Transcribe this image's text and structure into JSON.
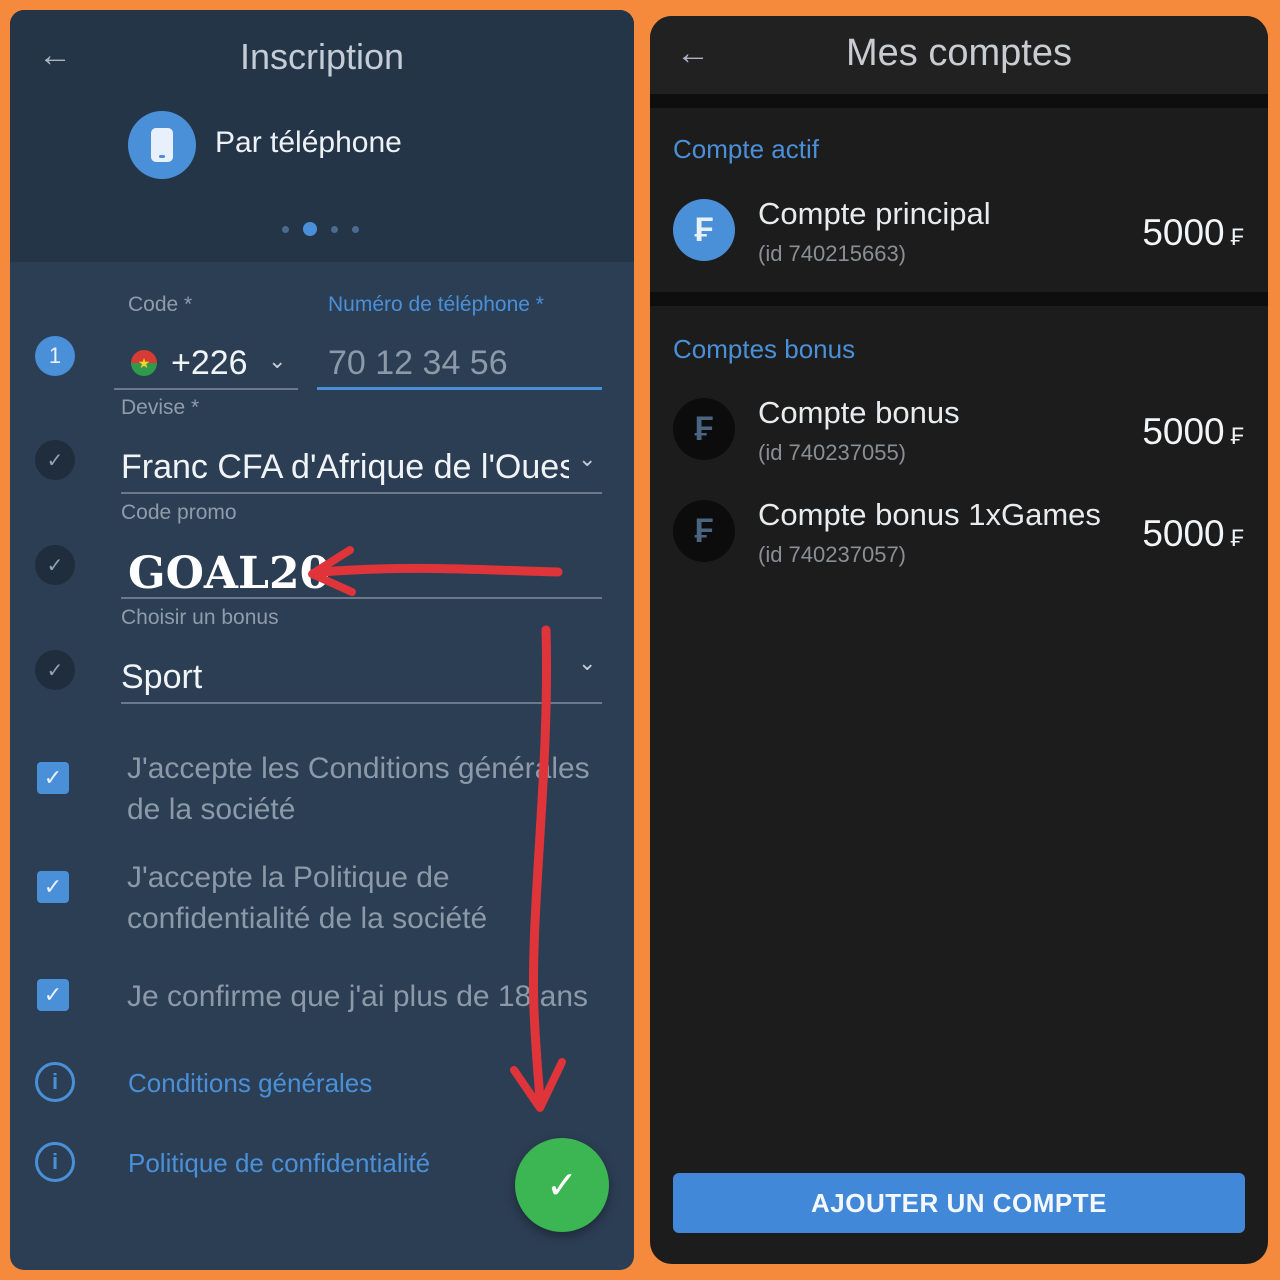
{
  "registration": {
    "title": "Inscription",
    "method_label": "Par téléphone",
    "step_number": "1",
    "code_label": "Code *",
    "code_value": "+226",
    "phone_label": "Numéro de téléphone *",
    "phone_placeholder": "70 12 34 56",
    "currency_label": "Devise *",
    "currency_value": "Franc CFA d'Afrique de l'Ouest",
    "promo_label": "Code promo",
    "promo_value": "GOAL20",
    "bonus_label": "Choisir un bonus",
    "bonus_value": "Sport",
    "checkboxes": [
      {
        "text": "J'accepte les Conditions générales de la société",
        "checked": true
      },
      {
        "text": "J'accepte la Politique de confidentialité de la société",
        "checked": true
      },
      {
        "text": "Je confirme que j'ai plus de 18 ans",
        "checked": true
      }
    ],
    "links": [
      {
        "label": "Conditions générales"
      },
      {
        "label": "Politique de confidentialité"
      }
    ],
    "carousel": {
      "count": 4,
      "active_index": 1
    }
  },
  "accounts": {
    "title": "Mes comptes",
    "active_section_title": "Compte actif",
    "bonus_section_title": "Comptes bonus",
    "currency_symbol": "₣",
    "active_account": {
      "name": "Compte principal",
      "id_text": "(id 740215663)",
      "amount": "5000"
    },
    "bonus_accounts": [
      {
        "name": "Compte bonus",
        "id_text": "(id 740237055)",
        "amount": "5000"
      },
      {
        "name": "Compte bonus 1xGames",
        "id_text": "(id 740237057)",
        "amount": "5000"
      }
    ],
    "add_button_label": "AJOUTER UN COMPTE"
  },
  "colors": {
    "frame_orange": "#f58a3c",
    "accent_blue": "#4a90d9",
    "success_green": "#3cb553",
    "annotation_red": "#e0343b"
  },
  "icons": [
    "back-arrow-icon",
    "phone-icon",
    "check-icon",
    "chevron-down-icon",
    "info-icon",
    "franc-icon"
  ]
}
